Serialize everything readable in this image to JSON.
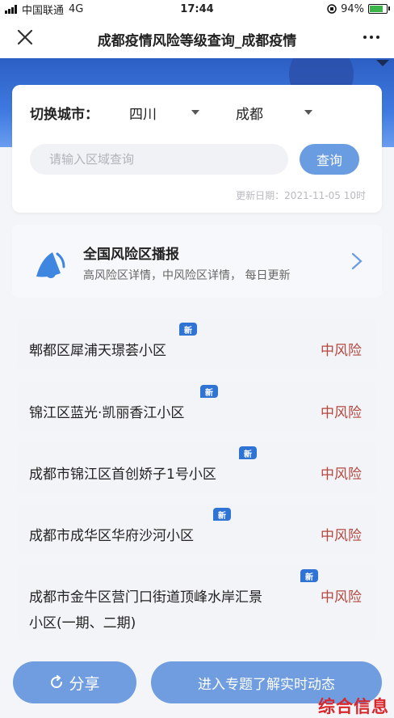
{
  "status": {
    "carrier": "中国联通",
    "network": "4G",
    "time": "17:44",
    "battery": "94%"
  },
  "nav": {
    "title": "成都疫情风险等级查询_成都疫情"
  },
  "search": {
    "city_label": "切换城市：",
    "province": "四川",
    "city": "成都",
    "placeholder": "请输入区域查询",
    "button": "查询",
    "update_date": "更新日期：2021-11-05 10时"
  },
  "broadcast": {
    "title": "全国风险区播报",
    "subtitle": "高风险区详情，中风险区详情， 每日更新"
  },
  "areas": [
    {
      "name": "郫都区犀浦天璟荟小区",
      "risk": "中风险",
      "badge": "新"
    },
    {
      "name": "锦江区蓝光·凯丽香江小区",
      "risk": "中风险",
      "badge": "新"
    },
    {
      "name": "成都市锦江区首创娇子1号小区",
      "risk": "中风险",
      "badge": "新"
    },
    {
      "name": "成都市成华区华府沙河小区",
      "risk": "中风险",
      "badge": "新"
    },
    {
      "name_line1": "成都市金牛区营门口街道顶峰水岸汇景",
      "name_line2": "小区(一期、二期)",
      "risk": "中风险",
      "badge": "新"
    }
  ],
  "bottom": {
    "share": "分享",
    "topic": "进入专题了解实时动态"
  },
  "watermark": "综合信息"
}
